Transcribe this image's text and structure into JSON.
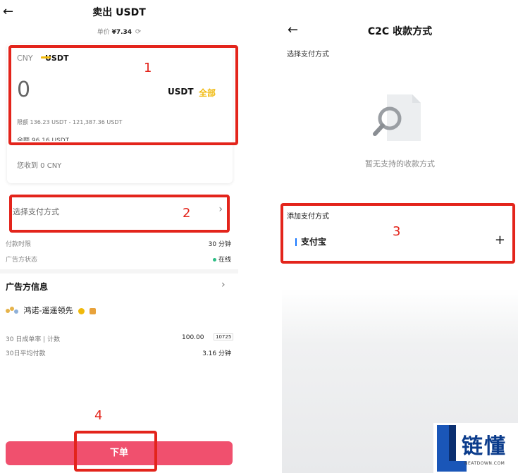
{
  "left": {
    "back_icon": "←",
    "title": "卖出 USDT",
    "price_label": "单价",
    "price_value": "¥7.34",
    "refresh_icon": "⟳",
    "tabs": [
      "CNY",
      "USDT"
    ],
    "amount_value": "0",
    "amount_unit": "USDT",
    "all_label": "全部",
    "limit_text": "限额 136.23 USDT - 121,387.36 USDT",
    "balance_text": "余额 96.16 USDT",
    "receive_text": "您收到 0 CNY",
    "payment_select_label": "选择支付方式",
    "chevron": "›",
    "pay_time_label": "付款时限",
    "pay_time_value": "30 分钟",
    "adv_status_label": "广告方状态",
    "adv_status_value": "在线",
    "advertiser_info_title": "广告方信息",
    "advertiser_name": "鸿诺-遥遥领先",
    "stat1_label": "30 日成单率 | 计数",
    "stat1_value": "100.00",
    "stat1_count": "10725",
    "stat2_label": "30日平均付款",
    "stat2_value": "3.16 分钟",
    "order_button": "下单"
  },
  "right": {
    "back_icon": "←",
    "title": "C2C 收款方式",
    "select_label": "选择支付方式",
    "empty_text": "暂无支持的收款方式",
    "add_label": "添加支付方式",
    "alipay_label": "支付宝",
    "plus_icon": "+"
  },
  "annotations": [
    "1",
    "2",
    "3",
    "4"
  ],
  "logo": {
    "cn": "链懂",
    "en": "NEATDOWN.COM"
  },
  "colors": {
    "accent": "#f0b90b",
    "sell_button": "#f0506e",
    "highlight": "#e3241b",
    "online": "#2ebd85"
  }
}
